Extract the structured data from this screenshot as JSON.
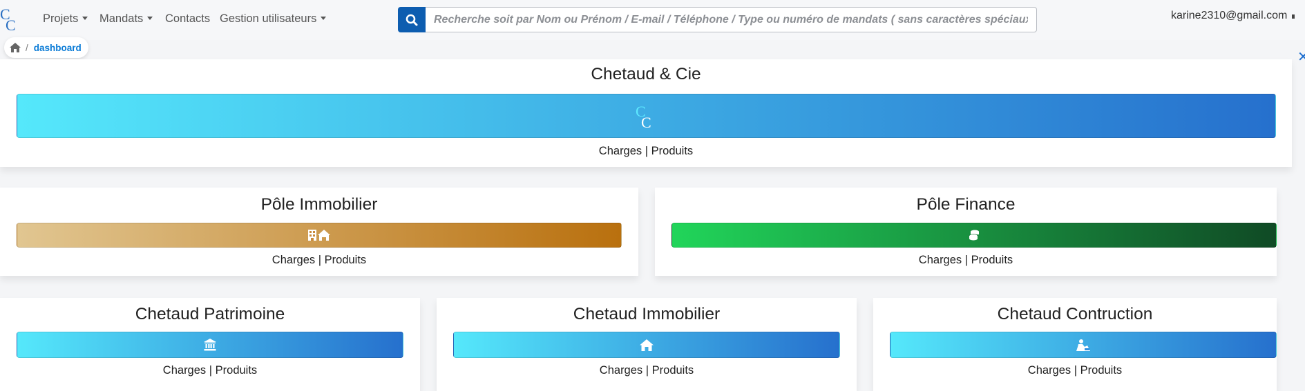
{
  "navbar": {
    "logo_alt": "CC",
    "menu": [
      {
        "label": "Projets",
        "has_dropdown": true
      },
      {
        "label": "Mandats",
        "has_dropdown": true
      },
      {
        "label": "Contacts",
        "has_dropdown": false
      },
      {
        "label": "Gestion utilisateurs",
        "has_dropdown": true
      }
    ],
    "search": {
      "placeholder": "Recherche soit par Nom ou Prénom / E-mail / Téléphone / Type ou numéro de mandats ( sans caractères spéciaux )",
      "value": "",
      "button_icon": "search-icon"
    },
    "user_email": "karine2310@gmail.com"
  },
  "breadcrumb": {
    "home_icon": "home-icon",
    "separator": "/",
    "current": "dashboard"
  },
  "colors": {
    "brand_blue": "#0d5db0",
    "link_blue": "#0a7bd6",
    "gradient_blue": [
      "#55e8fb",
      "#2670cd"
    ],
    "gradient_gold": [
      "#e1c691",
      "#b9700e"
    ],
    "gradient_green": [
      "#21d55a",
      "#104a25"
    ]
  },
  "cards": {
    "main": {
      "title": "Chetaud & Cie",
      "icon": "cc-logo-icon",
      "charges": "Charges",
      "sep": "|",
      "produits": "Produits"
    },
    "immobilier_pole": {
      "title": "Pôle Immobilier",
      "icon": "building-house-icon",
      "charges": "Charges",
      "sep": "|",
      "produits": "Produits"
    },
    "finance_pole": {
      "title": "Pôle Finance",
      "icon": "coins-icon",
      "charges": "Charges",
      "sep": "|",
      "produits": "Produits"
    },
    "patrimoine": {
      "title": "Chetaud Patrimoine",
      "icon": "bank-icon",
      "charges": "Charges",
      "sep": "|",
      "produits": "Produits"
    },
    "immobilier": {
      "title": "Chetaud Immobilier",
      "icon": "house-icon",
      "charges": "Charges",
      "sep": "|",
      "produits": "Produits"
    },
    "construction": {
      "title": "Chetaud Contruction",
      "icon": "builder-icon",
      "charges": "Charges",
      "sep": "|",
      "produits": "Produits"
    }
  }
}
